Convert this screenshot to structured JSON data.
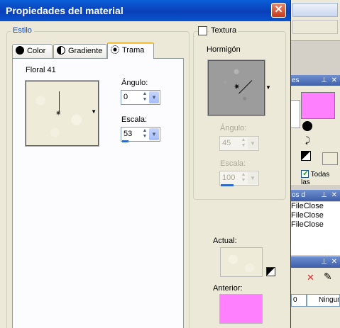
{
  "dialog": {
    "title": "Propiedades del material",
    "close_glyph": "✕"
  },
  "style_group": {
    "label": "Estilo",
    "tabs": [
      {
        "label": "Color",
        "icon": "filled-circle-icon"
      },
      {
        "label": "Gradiente",
        "icon": "half-circle-icon"
      },
      {
        "label": "Trama",
        "icon": "pattern-icon",
        "active": true
      }
    ],
    "pattern_name": "Floral 41",
    "angle_label": "Ángulo:",
    "angle_value": "0",
    "scale_label": "Escala:",
    "scale_value": "53"
  },
  "texture_group": {
    "label": "Textura",
    "checked": false,
    "texture_name": "Hormigón",
    "angle_label": "Ángulo:",
    "angle_value": "45",
    "scale_label": "Escala:",
    "scale_value": "100"
  },
  "current": {
    "label": "Actual:"
  },
  "previous": {
    "label": "Anterior:",
    "color": "#ff80ff"
  },
  "background_app": {
    "panel1_head": "es",
    "panel2_head": "os d",
    "checkbox_label": "Todas las",
    "history": [
      "FileClose",
      "FileClose",
      "FileClose"
    ],
    "layer_value": "0",
    "layer_mode": "Ningun"
  }
}
